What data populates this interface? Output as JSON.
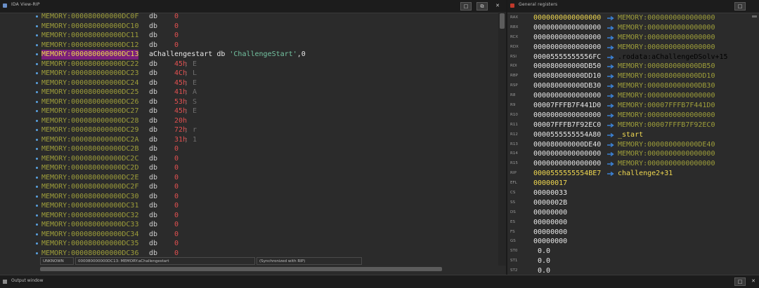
{
  "ida_view": {
    "title": "IDA View-RIP",
    "buttons": [
      "□",
      "⧉",
      "✕"
    ],
    "lines": [
      {
        "addr": "MEMORY:000080000000DC0F",
        "mn": "db",
        "val": "0",
        "cmt": ""
      },
      {
        "addr": "MEMORY:000080000000DC10",
        "mn": "db",
        "val": "0",
        "cmt": ""
      },
      {
        "addr": "MEMORY:000080000000DC11",
        "mn": "db",
        "val": "0",
        "cmt": ""
      },
      {
        "addr": "MEMORY:000080000000DC12",
        "mn": "db",
        "val": "0",
        "cmt": ""
      },
      {
        "addr": "MEMORY:000080000000DC13",
        "named": true,
        "label": "aChallengestart db ",
        "str": "'ChallengeStart'",
        "tail": ",0"
      },
      {
        "addr": "MEMORY:000080000000DC22",
        "mn": "db",
        "val": "45h",
        "cmt": "; E"
      },
      {
        "addr": "MEMORY:000080000000DC23",
        "mn": "db",
        "val": "4Ch",
        "cmt": "; L"
      },
      {
        "addr": "MEMORY:000080000000DC24",
        "mn": "db",
        "val": "45h",
        "cmt": "; E"
      },
      {
        "addr": "MEMORY:000080000000DC25",
        "mn": "db",
        "val": "41h",
        "cmt": "; A"
      },
      {
        "addr": "MEMORY:000080000000DC26",
        "mn": "db",
        "val": "53h",
        "cmt": "; S"
      },
      {
        "addr": "MEMORY:000080000000DC27",
        "mn": "db",
        "val": "45h",
        "cmt": "; E"
      },
      {
        "addr": "MEMORY:000080000000DC28",
        "mn": "db",
        "val": "20h",
        "cmt": ""
      },
      {
        "addr": "MEMORY:000080000000DC29",
        "mn": "db",
        "val": "72h",
        "cmt": "; r"
      },
      {
        "addr": "MEMORY:000080000000DC2A",
        "mn": "db",
        "val": "31h",
        "cmt": "; 1"
      },
      {
        "addr": "MEMORY:000080000000DC2B",
        "mn": "db",
        "val": "0",
        "cmt": ""
      },
      {
        "addr": "MEMORY:000080000000DC2C",
        "mn": "db",
        "val": "0",
        "cmt": ""
      },
      {
        "addr": "MEMORY:000080000000DC2D",
        "mn": "db",
        "val": "0",
        "cmt": ""
      },
      {
        "addr": "MEMORY:000080000000DC2E",
        "mn": "db",
        "val": "0",
        "cmt": ""
      },
      {
        "addr": "MEMORY:000080000000DC2F",
        "mn": "db",
        "val": "0",
        "cmt": ""
      },
      {
        "addr": "MEMORY:000080000000DC30",
        "mn": "db",
        "val": "0",
        "cmt": ""
      },
      {
        "addr": "MEMORY:000080000000DC31",
        "mn": "db",
        "val": "0",
        "cmt": ""
      },
      {
        "addr": "MEMORY:000080000000DC32",
        "mn": "db",
        "val": "0",
        "cmt": ""
      },
      {
        "addr": "MEMORY:000080000000DC33",
        "mn": "db",
        "val": "0",
        "cmt": ""
      },
      {
        "addr": "MEMORY:000080000000DC34",
        "mn": "db",
        "val": "0",
        "cmt": ""
      },
      {
        "addr": "MEMORY:000080000000DC35",
        "mn": "db",
        "val": "0",
        "cmt": ""
      },
      {
        "addr": "MEMORY:000080000000DC36",
        "mn": "db",
        "val": "0",
        "cmt": ""
      }
    ],
    "status": {
      "mode": "UNKNOWN",
      "location": "000080000000DC13: MEMORY:aChallengestart",
      "sync": "(Synchronized with RIP)"
    }
  },
  "registers": {
    "title": "General registers",
    "buttons": [
      "□"
    ],
    "rows": [
      {
        "name": "RAX",
        "value": "0000000000000000",
        "changed": true,
        "target": "MEMORY:0000000000000000",
        "kind": "mem"
      },
      {
        "name": "RBX",
        "value": "0000000000000000",
        "changed": false,
        "target": "MEMORY:0000000000000000",
        "kind": "mem"
      },
      {
        "name": "RCX",
        "value": "0000000000000000",
        "changed": false,
        "target": "MEMORY:0000000000000000",
        "kind": "mem"
      },
      {
        "name": "RDX",
        "value": "0000000000000000",
        "changed": false,
        "target": "MEMORY:0000000000000000",
        "kind": "mem"
      },
      {
        "name": "RSI",
        "value": "00005555555556FC",
        "changed": false,
        "target_seg": ".rodata:",
        "target": "aChallengeDSolv+15",
        "kind": "rodata"
      },
      {
        "name": "RDI",
        "value": "000080000000DB50",
        "changed": false,
        "target": "MEMORY:000080000000DB50",
        "kind": "mem"
      },
      {
        "name": "RBP",
        "value": "000080000000DD10",
        "changed": false,
        "target": "MEMORY:000080000000DD10",
        "kind": "mem"
      },
      {
        "name": "RSP",
        "value": "000080000000DB30",
        "changed": false,
        "target": "MEMORY:000080000000DB30",
        "kind": "mem"
      },
      {
        "name": "R8",
        "value": "0000000000000000",
        "changed": false,
        "target": "MEMORY:0000000000000000",
        "kind": "mem"
      },
      {
        "name": "R9",
        "value": "00007FFFB7F441D0",
        "changed": false,
        "target": "MEMORY:00007FFFB7F441D0",
        "kind": "mem"
      },
      {
        "name": "R10",
        "value": "0000000000000000",
        "changed": false,
        "target": "MEMORY:0000000000000000",
        "kind": "mem"
      },
      {
        "name": "R11",
        "value": "00007FFFB7F92EC0",
        "changed": false,
        "target": "MEMORY:00007FFFB7F92EC0",
        "kind": "mem"
      },
      {
        "name": "R12",
        "value": "0000555555554A80",
        "changed": false,
        "target": "_start",
        "kind": "sym"
      },
      {
        "name": "R13",
        "value": "000080000000DE40",
        "changed": false,
        "target": "MEMORY:000080000000DE40",
        "kind": "mem"
      },
      {
        "name": "R14",
        "value": "0000000000000000",
        "changed": false,
        "target": "MEMORY:0000000000000000",
        "kind": "mem"
      },
      {
        "name": "R15",
        "value": "0000000000000000",
        "changed": false,
        "target": "MEMORY:0000000000000000",
        "kind": "mem"
      },
      {
        "name": "RIP",
        "value": "0000555555554BE7",
        "changed": true,
        "target": "challenge2+31",
        "kind": "sym"
      },
      {
        "name": "EFL",
        "value": "00000017",
        "changed": true
      },
      {
        "name": "CS",
        "value": "00000033",
        "changed": false
      },
      {
        "name": "SS",
        "value": "0000002B",
        "changed": false
      },
      {
        "name": "DS",
        "value": "00000000",
        "changed": false
      },
      {
        "name": "ES",
        "value": "00000000",
        "changed": false
      },
      {
        "name": "FS",
        "value": "00000000",
        "changed": false
      },
      {
        "name": "GS",
        "value": "00000000",
        "changed": false
      },
      {
        "name": "ST0",
        "value": " 0.0",
        "changed": false
      },
      {
        "name": "ST1",
        "value": " 0.0",
        "changed": false
      },
      {
        "name": "ST2",
        "value": " 0.0",
        "changed": false
      }
    ]
  },
  "output": {
    "title": "Output window",
    "buttons": [
      "□",
      "✕"
    ]
  },
  "colors": {
    "address": "#9e9e3a",
    "highlight_bg": "#7a1f7a",
    "changed_value": "#f0d850",
    "number": "#e05050",
    "string": "#73c2a0",
    "arrow": "#3b82d6",
    "background": "#2b2b2b"
  }
}
